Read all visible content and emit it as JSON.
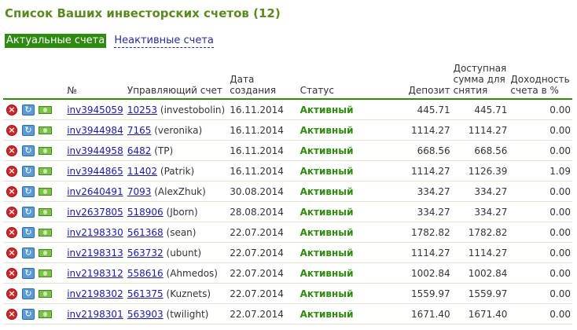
{
  "page": {
    "title": "Список Ваших инвесторских счетов (12)"
  },
  "tabs": {
    "active": "Актуальные счета",
    "inactive": "Неактивные счета"
  },
  "table": {
    "headers": {
      "num": "№",
      "manager": "Управляющий счет",
      "created": "Дата создания",
      "status": "Статус",
      "deposit": "Депозит",
      "available": "Доступная сумма для снятия",
      "yield": "Доходность счета в %"
    },
    "rows": [
      {
        "account": "inv3945059",
        "manager_id": "10253",
        "manager_name": "(investobolin)",
        "date": "16.11.2014",
        "status": "Активный",
        "deposit": "445.71",
        "available": "445.71",
        "yield": "0.00"
      },
      {
        "account": "inv3944984",
        "manager_id": "7165",
        "manager_name": "(veronika)",
        "date": "16.11.2014",
        "status": "Активный",
        "deposit": "1114.27",
        "available": "1114.27",
        "yield": "0.00"
      },
      {
        "account": "inv3944958",
        "manager_id": "6482",
        "manager_name": "(TP)",
        "date": "16.11.2014",
        "status": "Активный",
        "deposit": "668.56",
        "available": "668.56",
        "yield": "0.00"
      },
      {
        "account": "inv3944865",
        "manager_id": "11402",
        "manager_name": "(Patrik)",
        "date": "16.11.2014",
        "status": "Активный",
        "deposit": "1114.27",
        "available": "1126.39",
        "yield": "1.09"
      },
      {
        "account": "inv2640491",
        "manager_id": "7093",
        "manager_name": "(AlexZhuk)",
        "date": "30.08.2014",
        "status": "Активный",
        "deposit": "334.27",
        "available": "334.27",
        "yield": "0.00"
      },
      {
        "account": "inv2637805",
        "manager_id": "518906",
        "manager_name": "(Jborn)",
        "date": "28.08.2014",
        "status": "Активный",
        "deposit": "334.27",
        "available": "334.27",
        "yield": "0.00"
      },
      {
        "account": "inv2198330",
        "manager_id": "561368",
        "manager_name": "(sean)",
        "date": "22.07.2014",
        "status": "Активный",
        "deposit": "1782.82",
        "available": "1782.82",
        "yield": "0.00"
      },
      {
        "account": "inv2198313",
        "manager_id": "563732",
        "manager_name": "(ubunt)",
        "date": "22.07.2014",
        "status": "Активный",
        "deposit": "1114.27",
        "available": "1114.27",
        "yield": "0.00"
      },
      {
        "account": "inv2198312",
        "manager_id": "558616",
        "manager_name": "(Ahmedos)",
        "date": "22.07.2014",
        "status": "Активный",
        "deposit": "1002.84",
        "available": "1002.84",
        "yield": "0.00"
      },
      {
        "account": "inv2198302",
        "manager_id": "561375",
        "manager_name": "(Kuznets)",
        "date": "22.07.2014",
        "status": "Активный",
        "deposit": "1559.97",
        "available": "1559.97",
        "yield": "0.00"
      },
      {
        "account": "inv2198301",
        "manager_id": "563903",
        "manager_name": "(twilight)",
        "date": "22.07.2014",
        "status": "Активный",
        "deposit": "1671.40",
        "available": "1671.40",
        "yield": "0.00"
      }
    ]
  },
  "icons": {
    "delete": "delete-icon",
    "refresh": "refresh-icon",
    "money": "money-icon"
  },
  "colors": {
    "accent": "#2e8b10",
    "title": "#5a8a1f",
    "link": "#1a1aa6"
  }
}
